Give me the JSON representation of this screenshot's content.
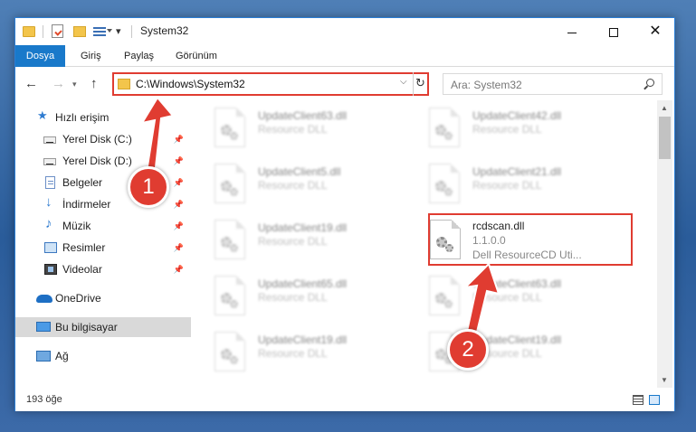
{
  "window": {
    "title": "System32",
    "quick_access_more": "▾"
  },
  "ribbon": {
    "tabs": [
      "Dosya",
      "Giriş",
      "Paylaş",
      "Görünüm"
    ]
  },
  "address_bar": {
    "path": "C:\\Windows\\System32"
  },
  "search": {
    "placeholder": "Ara: System32"
  },
  "sidebar": {
    "items": [
      {
        "label": "Hızlı erişim",
        "icon": "star-icon",
        "pinned": false
      },
      {
        "label": "Yerel Disk (C:)",
        "icon": "disk-icon",
        "pinned": true
      },
      {
        "label": "Yerel Disk (D:)",
        "icon": "disk-icon",
        "pinned": true
      },
      {
        "label": "Belgeler",
        "icon": "documents-icon",
        "pinned": true
      },
      {
        "label": "İndirmeler",
        "icon": "download-icon",
        "pinned": true
      },
      {
        "label": "Müzik",
        "icon": "music-icon",
        "pinned": true
      },
      {
        "label": "Resimler",
        "icon": "pictures-icon",
        "pinned": true
      },
      {
        "label": "Videolar",
        "icon": "videos-icon",
        "pinned": true
      },
      {
        "label": "OneDrive",
        "icon": "onedrive-icon",
        "pinned": false
      },
      {
        "label": "Bu bilgisayar",
        "icon": "this-pc-icon",
        "pinned": false,
        "selected": true
      },
      {
        "label": "Ağ",
        "icon": "network-icon",
        "pinned": false
      }
    ]
  },
  "files": {
    "left_column": [
      {
        "name": "UpdateClient63.dll",
        "desc": "Resource DLL"
      },
      {
        "name": "UpdateClient5.dll",
        "desc": "Resource DLL"
      },
      {
        "name": "UpdateClient19.dll",
        "desc": "Resource DLL"
      },
      {
        "name": "UpdateClient65.dll",
        "desc": "Resource DLL"
      },
      {
        "name": "UpdateClient19.dll",
        "desc": "Resource DLL"
      }
    ],
    "right_column": [
      {
        "name": "UpdateClient42.dll",
        "desc": "Resource DLL"
      },
      {
        "name": "UpdateClient21.dll",
        "desc": "Resource DLL"
      },
      {
        "name": "rcdscan.dll",
        "version": "1.1.0.0",
        "desc": "Dell ResourceCD Uti...",
        "highlighted": true
      },
      {
        "name": "UpdateClient63.dll",
        "desc": "Resource DLL"
      },
      {
        "name": "UpdateClient19.dll",
        "desc": "Resource DLL"
      }
    ]
  },
  "status": {
    "item_count": "193 öğe"
  },
  "annotations": {
    "badge1": "1",
    "badge2": "2",
    "color": "#e03c31"
  },
  "colors": {
    "accent": "#1979ca",
    "highlight_border": "#e03c31"
  }
}
